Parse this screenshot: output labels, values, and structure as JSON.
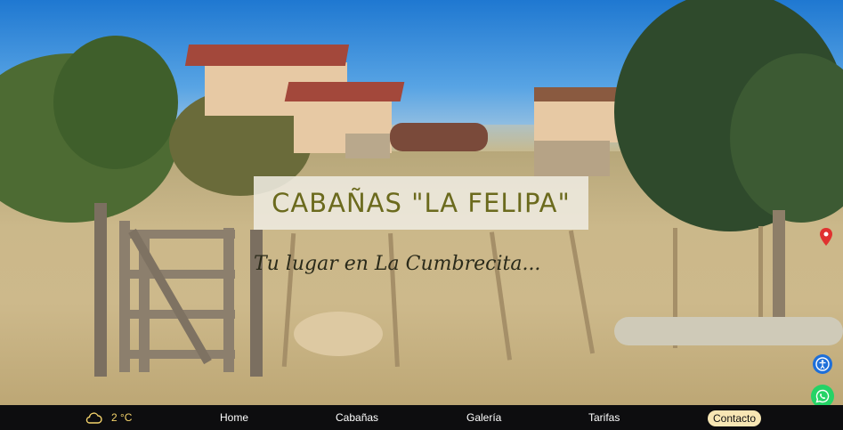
{
  "hero": {
    "title": "CABAÑAS \"LA FELIPA\"",
    "subtitle": "Tu lugar en La Cumbrecita..."
  },
  "navbar": {
    "weather": {
      "icon": "cloud-icon",
      "temperature": "2 °C"
    },
    "items": [
      {
        "label": "Home"
      },
      {
        "label": "Cabañas"
      },
      {
        "label": "Galería"
      },
      {
        "label": "Tarifas"
      },
      {
        "label": "Contacto"
      }
    ]
  },
  "floating": {
    "accessibility_icon": "accessibility-icon",
    "whatsapp_icon": "whatsapp-icon"
  },
  "colors": {
    "title_text": "#6b6a1d",
    "nav_bg": "#0d0d0f",
    "weather_text": "#f4d36b",
    "contact_bg": "#f7e6b4",
    "whatsapp": "#25d366",
    "accessibility": "#1e6fd9"
  }
}
